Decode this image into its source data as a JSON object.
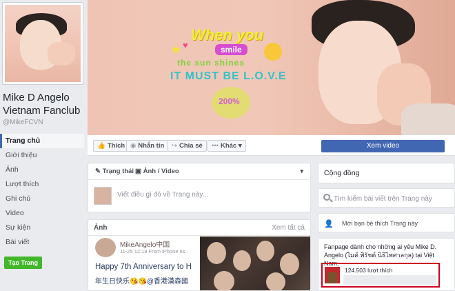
{
  "page": {
    "name": "Mike D Angelo Vietnam Fanclub",
    "handle": "@MikeFCVN"
  },
  "cover": {
    "line1": "When you",
    "smile": "smile",
    "line2": "the sun shines",
    "line3": "IT MUST BE L.O.V.E",
    "badge": "200%"
  },
  "left_nav": {
    "items": [
      "Trang chủ",
      "Giới thiệu",
      "Ảnh",
      "Lượt thích",
      "Ghi chú",
      "Video",
      "Sự kiện",
      "Bài viết"
    ],
    "create_page": "Tạo Trang"
  },
  "actions": {
    "like": "Thích",
    "message": "Nhắn tin",
    "share": "Chia sẻ",
    "more": "Khác",
    "watch_video": "Xem video"
  },
  "composer": {
    "status_tab": "Trạng thái",
    "photo_tab": "Ảnh / Video",
    "placeholder": "Viết điều gì đó về Trang này..."
  },
  "photos": {
    "title": "Ảnh",
    "see_all": "Xem tất cả",
    "post_name": "MikeAngelo中国",
    "post_meta": "11-25 12:19 From iPhone 6s",
    "post_line1": "Happy 7th Anniversary to H",
    "post_line2": "年生日快乐😘😘@香港漢森國"
  },
  "right": {
    "community": "Cộng đồng",
    "search_placeholder": "Tìm kiếm bài viết trên Trang này",
    "invite": "Mời bạn bè thích Trang này",
    "fan_desc": "Fanpage dành cho những ai yêu Mike D. Angelo (ไมค์ พิรัชต์ นิธิไพศาลกุล) tại Việt Nam.",
    "likes": "124.503 lượt thích"
  },
  "colors": {
    "primary": "#4267b2",
    "create_green": "#42b72a",
    "highlight_red": "#d0021b",
    "background": "#e9ebee"
  }
}
